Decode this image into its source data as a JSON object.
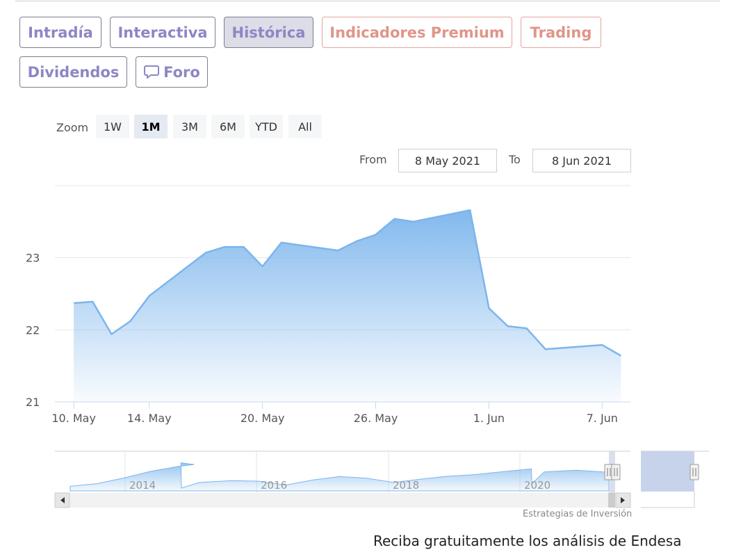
{
  "tabs": [
    {
      "label": "Intradía",
      "state": "normal"
    },
    {
      "label": "Interactiva",
      "state": "normal"
    },
    {
      "label": "Histórica",
      "state": "active"
    },
    {
      "label": "Indicadores Premium",
      "state": "premium"
    },
    {
      "label": "Trading",
      "state": "premium"
    },
    {
      "label": "Dividendos",
      "state": "normal"
    },
    {
      "label": "Foro",
      "state": "normal",
      "icon": "speech-bubble-icon"
    }
  ],
  "zoom": {
    "label": "Zoom",
    "buttons": [
      "1W",
      "1M",
      "3M",
      "6M",
      "YTD",
      "All"
    ],
    "selected": "1M"
  },
  "range": {
    "from_label": "From",
    "from_value": "8 May 2021",
    "to_label": "To",
    "to_value": "8 Jun 2021"
  },
  "colors": {
    "line": "#7cb5ec",
    "tab_text": "#8c87c5",
    "premium_text": "#e0958a"
  },
  "chart_data": {
    "type": "area",
    "x": [
      "2021-05-10",
      "2021-05-11",
      "2021-05-12",
      "2021-05-13",
      "2021-05-14",
      "2021-05-17",
      "2021-05-18",
      "2021-05-19",
      "2021-05-20",
      "2021-05-21",
      "2021-05-24",
      "2021-05-25",
      "2021-05-26",
      "2021-05-27",
      "2021-05-28",
      "2021-05-31",
      "2021-06-01",
      "2021-06-02",
      "2021-06-03",
      "2021-06-04",
      "2021-06-07",
      "2021-06-08"
    ],
    "series": [
      {
        "values": [
          22.37,
          22.39,
          21.94,
          22.12,
          22.47,
          23.07,
          23.15,
          23.15,
          22.88,
          23.21,
          23.1,
          23.23,
          23.32,
          23.54,
          23.5,
          23.66,
          22.3,
          22.05,
          22.02,
          21.73,
          21.79,
          21.64
        ]
      }
    ],
    "y_ticks": [
      21,
      22,
      23
    ],
    "ylim": [
      21,
      24
    ],
    "x_tick_labels": [
      "10. May",
      "14. May",
      "20. May",
      "26. May",
      "1. Jun",
      "7. Jun"
    ],
    "grid": true,
    "navigator": {
      "labels": [
        "2014",
        "2016",
        "2018",
        "2020"
      ]
    }
  },
  "credit": "Estrategias de Inversión",
  "footer": "Reciba gratuitamente los análisis de Endesa"
}
